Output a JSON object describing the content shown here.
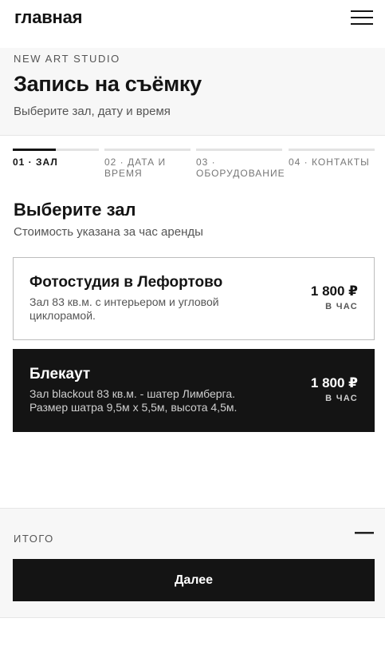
{
  "header": {
    "logo": "главная",
    "menu_icon": "hamburger-menu-icon"
  },
  "booking": {
    "studio": "NEW ART STUDIO",
    "title": "Запись на съёмку",
    "subtitle": "Выберите зал, дату и время"
  },
  "steps": [
    {
      "label": "01 · ЗАЛ",
      "progress": 0.5,
      "active": true
    },
    {
      "label": "02 · ДАТА И ВРЕМЯ",
      "progress": 0,
      "active": false
    },
    {
      "label": "03 · ОБОРУДОВАНИЕ",
      "progress": 0,
      "active": false
    },
    {
      "label": "04 · КОНТАКТЫ",
      "progress": 0,
      "active": false
    }
  ],
  "section": {
    "title": "Выберите зал",
    "subtitle": "Стоимость указана за час аренды"
  },
  "halls": [
    {
      "name": "Фотостудия в Лефортово",
      "description": "Зал 83 кв.м. с интерьером и угловой циклорамой.",
      "price": "1 800 ₽",
      "unit": "В ЧАС",
      "selected": false
    },
    {
      "name": "Блекаут",
      "description": "Зал blackout 83 кв.м. - шатер Лимберга. Размер шатра 9,5м x 5,5м, высота 4,5м.",
      "price": "1 800 ₽",
      "unit": "В ЧАС",
      "selected": true
    }
  ],
  "footer": {
    "total_label": "ИТОГО",
    "total_value": "—",
    "next_label": "Далее"
  }
}
